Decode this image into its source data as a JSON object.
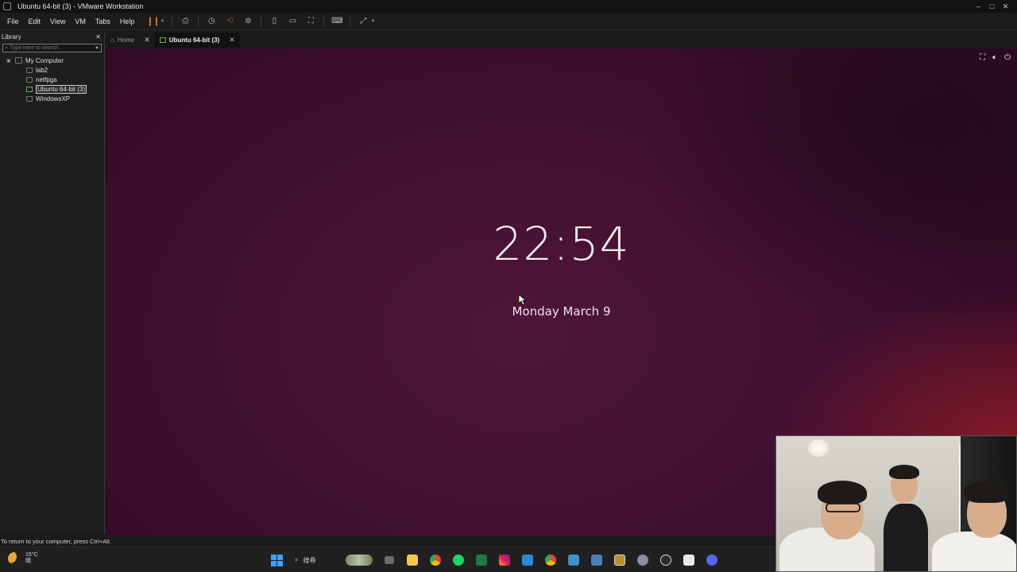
{
  "window": {
    "title": "Ubuntu 64-bit (3) - VMware Workstation",
    "controls": [
      "–",
      "□",
      "✕"
    ]
  },
  "menu": {
    "items": [
      "File",
      "Edit",
      "View",
      "VM",
      "Tabs",
      "Help"
    ]
  },
  "library": {
    "title": "Library",
    "close": "✕",
    "search_placeholder": "Type here to search",
    "tree": {
      "root": "My Computer",
      "children": [
        "lab2",
        "netfpga",
        "Ubuntu 64-bit (3)",
        "WindowsXP"
      ],
      "selected_index": 2
    }
  },
  "tabs": [
    {
      "label": "Home",
      "active": false,
      "close": "✕"
    },
    {
      "label": "Ubuntu 64-bit (3)",
      "active": true,
      "close": "✕"
    }
  ],
  "vm": {
    "lock_screen": {
      "time": "22:54",
      "date": "Monday March 9"
    },
    "status_icons": [
      "network-icon",
      "volume-icon",
      "power-icon"
    ]
  },
  "statusbar": {
    "text": "To return to your computer, press Ctrl+Alt."
  },
  "taskbar": {
    "weather": {
      "temperature": "15°C",
      "condition": "晴"
    },
    "search_label": "搜尋"
  },
  "colors": {
    "ubuntu_bg": "#3f1030",
    "accent_pause": "#e8781e",
    "selected_vm_icon": "#6fb04a"
  }
}
